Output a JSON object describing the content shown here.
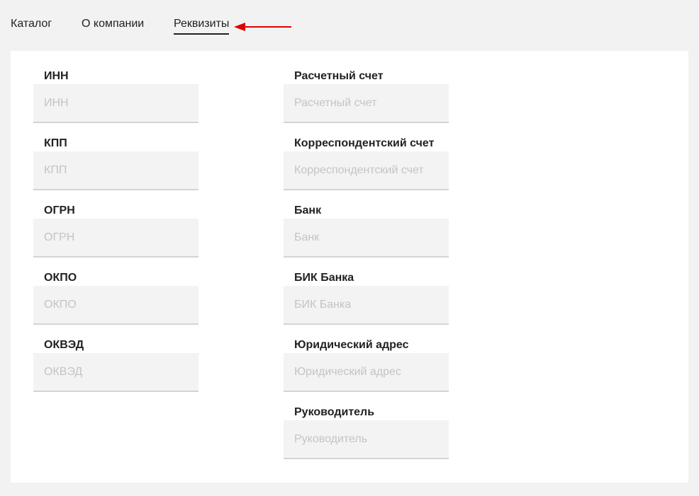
{
  "nav": {
    "tabs": [
      {
        "label": "Каталог"
      },
      {
        "label": "О компании"
      },
      {
        "label": "Реквизиты"
      }
    ],
    "active_tab": "Реквизиты"
  },
  "colors": {
    "arrow": "#e00000",
    "panel": "#ffffff",
    "input_bg": "#f3f3f3",
    "page_bg": "#f2f2f2"
  },
  "form": {
    "left": [
      {
        "label": "ИНН",
        "placeholder": "ИНН",
        "value": ""
      },
      {
        "label": "КПП",
        "placeholder": "КПП",
        "value": ""
      },
      {
        "label": "ОГРН",
        "placeholder": "ОГРН",
        "value": ""
      },
      {
        "label": "ОКПО",
        "placeholder": "ОКПО",
        "value": ""
      },
      {
        "label": "ОКВЭД",
        "placeholder": "ОКВЭД",
        "value": ""
      }
    ],
    "right": [
      {
        "label": "Расчетный счет",
        "placeholder": "Расчетный счет",
        "value": ""
      },
      {
        "label": "Корреспондентский счет",
        "placeholder": "Корреспондентский счет",
        "value": ""
      },
      {
        "label": "Банк",
        "placeholder": "Банк",
        "value": ""
      },
      {
        "label": "БИК Банка",
        "placeholder": "БИК Банка",
        "value": ""
      },
      {
        "label": "Юридический адрес",
        "placeholder": "Юридический адрес",
        "value": ""
      },
      {
        "label": "Руководитель",
        "placeholder": "Руководитель",
        "value": ""
      }
    ]
  }
}
